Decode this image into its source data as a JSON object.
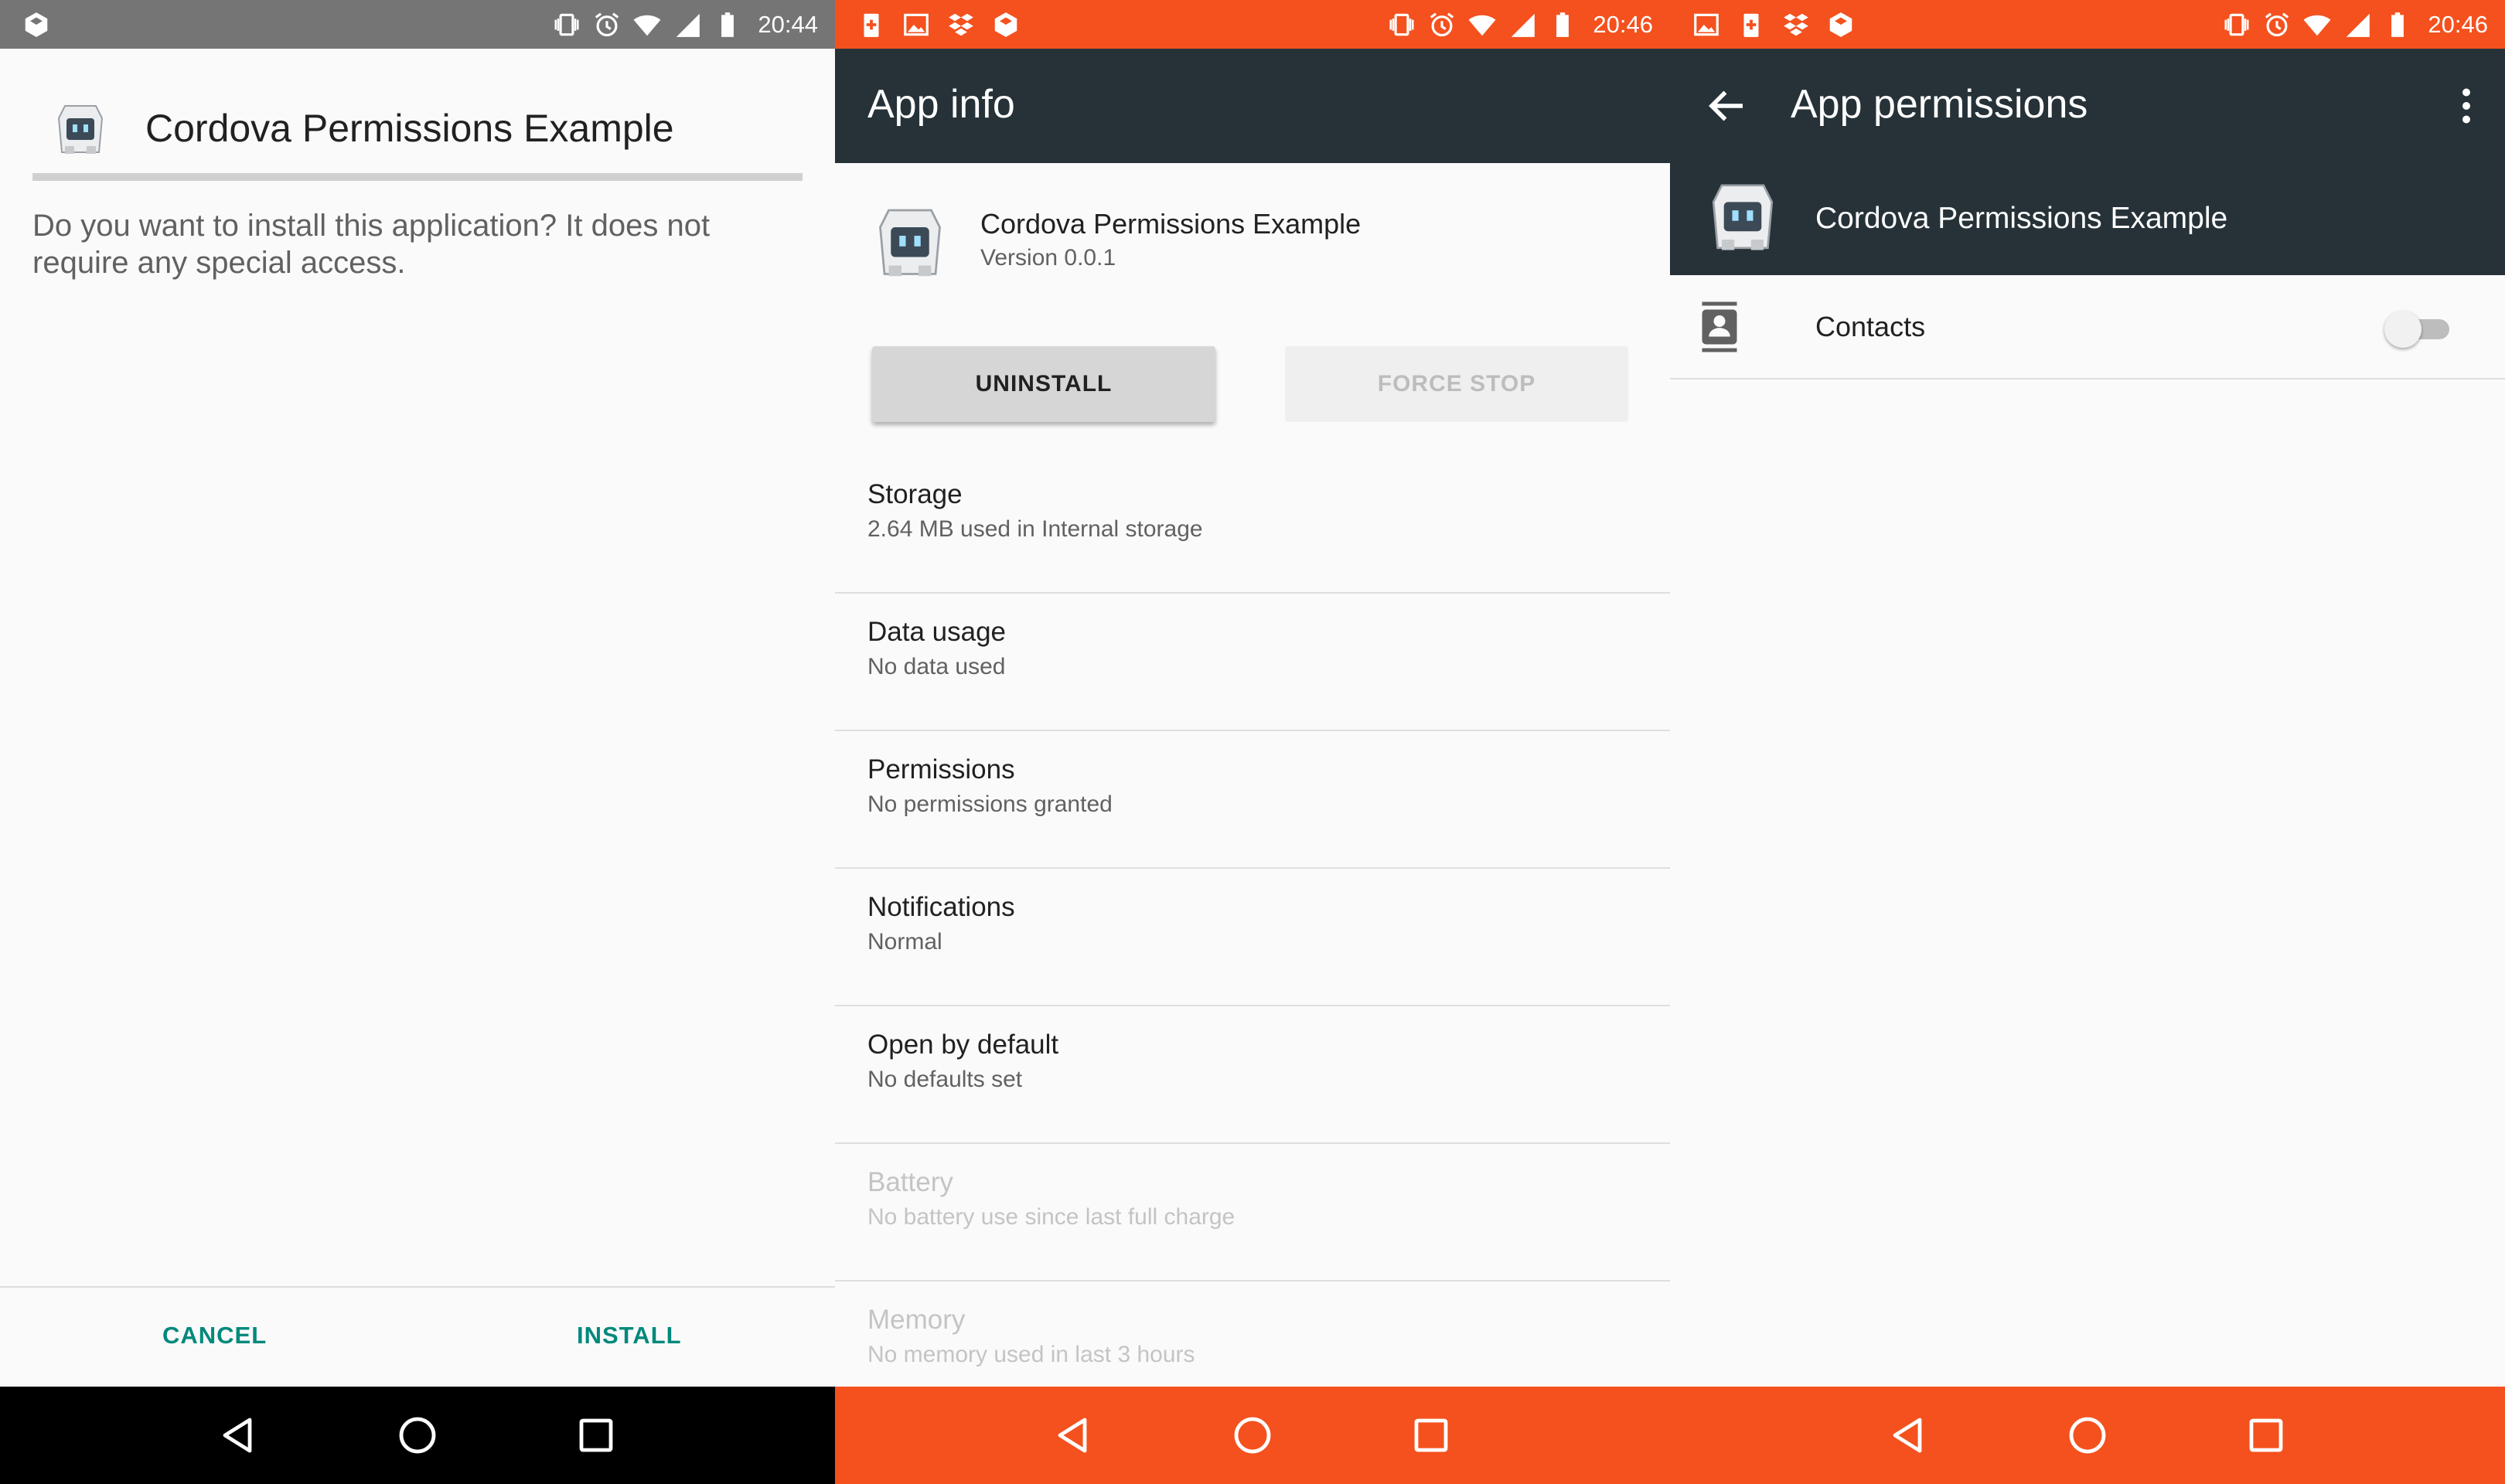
{
  "colors": {
    "status_gray": "#757575",
    "status_orange": "#f4511e",
    "toolbar_dark": "#263238",
    "accent_teal": "#00897b"
  },
  "installer": {
    "status_time": "20:44",
    "app_name": "Cordova Permissions Example",
    "message": "Do you want to install this application? It does not require any special access.",
    "cancel_label": "CANCEL",
    "install_label": "INSTALL"
  },
  "app_info": {
    "status_time": "20:46",
    "toolbar_title": "App info",
    "app_name": "Cordova Permissions Example",
    "version": "Version 0.0.1",
    "uninstall_label": "UNINSTALL",
    "force_stop_label": "FORCE STOP",
    "items": [
      {
        "title": "Storage",
        "subtitle": "2.64 MB used in Internal storage",
        "enabled": true
      },
      {
        "title": "Data usage",
        "subtitle": "No data used",
        "enabled": true
      },
      {
        "title": "Permissions",
        "subtitle": "No permissions granted",
        "enabled": true
      },
      {
        "title": "Notifications",
        "subtitle": "Normal",
        "enabled": true
      },
      {
        "title": "Open by default",
        "subtitle": "No defaults set",
        "enabled": true
      },
      {
        "title": "Battery",
        "subtitle": "No battery use since last full charge",
        "enabled": false
      },
      {
        "title": "Memory",
        "subtitle": "No memory used in last 3 hours",
        "enabled": false
      }
    ]
  },
  "app_permissions": {
    "status_time": "20:46",
    "toolbar_title": "App permissions",
    "app_name": "Cordova Permissions Example",
    "permissions": [
      {
        "label": "Contacts",
        "icon": "contacts-icon",
        "enabled": false
      }
    ]
  }
}
